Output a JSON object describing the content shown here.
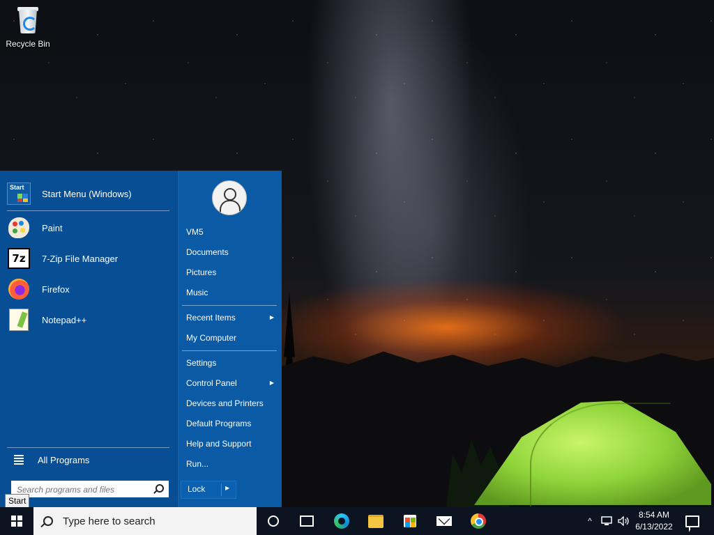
{
  "desktop": {
    "icons": [
      {
        "label": "Recycle Bin",
        "icon": "recycle-bin-icon"
      }
    ]
  },
  "start_menu": {
    "pinned": [
      {
        "label": "Start Menu (Windows)",
        "icon": "start-menu-icon"
      }
    ],
    "programs": [
      {
        "label": "Paint",
        "icon": "paint-icon"
      },
      {
        "label": "7-Zip File Manager",
        "icon": "7zip-icon"
      },
      {
        "label": "Firefox",
        "icon": "firefox-icon"
      },
      {
        "label": "Notepad++",
        "icon": "notepad-plus-plus-icon"
      }
    ],
    "all_programs_label": "All Programs",
    "search_placeholder": "Search programs and files",
    "user_avatar_icon": "user-avatar-icon",
    "right_items": [
      {
        "label": "VM5",
        "submenu": false
      },
      {
        "label": "Documents",
        "submenu": false
      },
      {
        "label": "Pictures",
        "submenu": false
      },
      {
        "label": "Music",
        "submenu": false
      },
      {
        "label": "Recent Items",
        "submenu": true
      },
      {
        "label": "My Computer",
        "submenu": false
      },
      {
        "label": "Settings",
        "submenu": false
      },
      {
        "label": "Control Panel",
        "submenu": true
      },
      {
        "label": "Devices and Printers",
        "submenu": false
      },
      {
        "label": "Default Programs",
        "submenu": false
      },
      {
        "label": "Help and Support",
        "submenu": false
      },
      {
        "label": "Run...",
        "submenu": false
      }
    ],
    "lock_label": "Lock",
    "submenu_arrow": "▶"
  },
  "tooltip": {
    "text": "Start"
  },
  "taskbar": {
    "search_placeholder": "Type here to search",
    "apps": [
      "cortana-icon",
      "task-view-icon",
      "edge-icon",
      "file-explorer-icon",
      "store-icon",
      "mail-icon",
      "chrome-icon"
    ],
    "tray": {
      "chevron": "^",
      "time": "8:54 AM",
      "date": "6/13/2022"
    }
  },
  "colors": {
    "start_menu_left": "#074e95",
    "start_menu_right": "#0a5aa6",
    "taskbar": "#0b1420"
  }
}
